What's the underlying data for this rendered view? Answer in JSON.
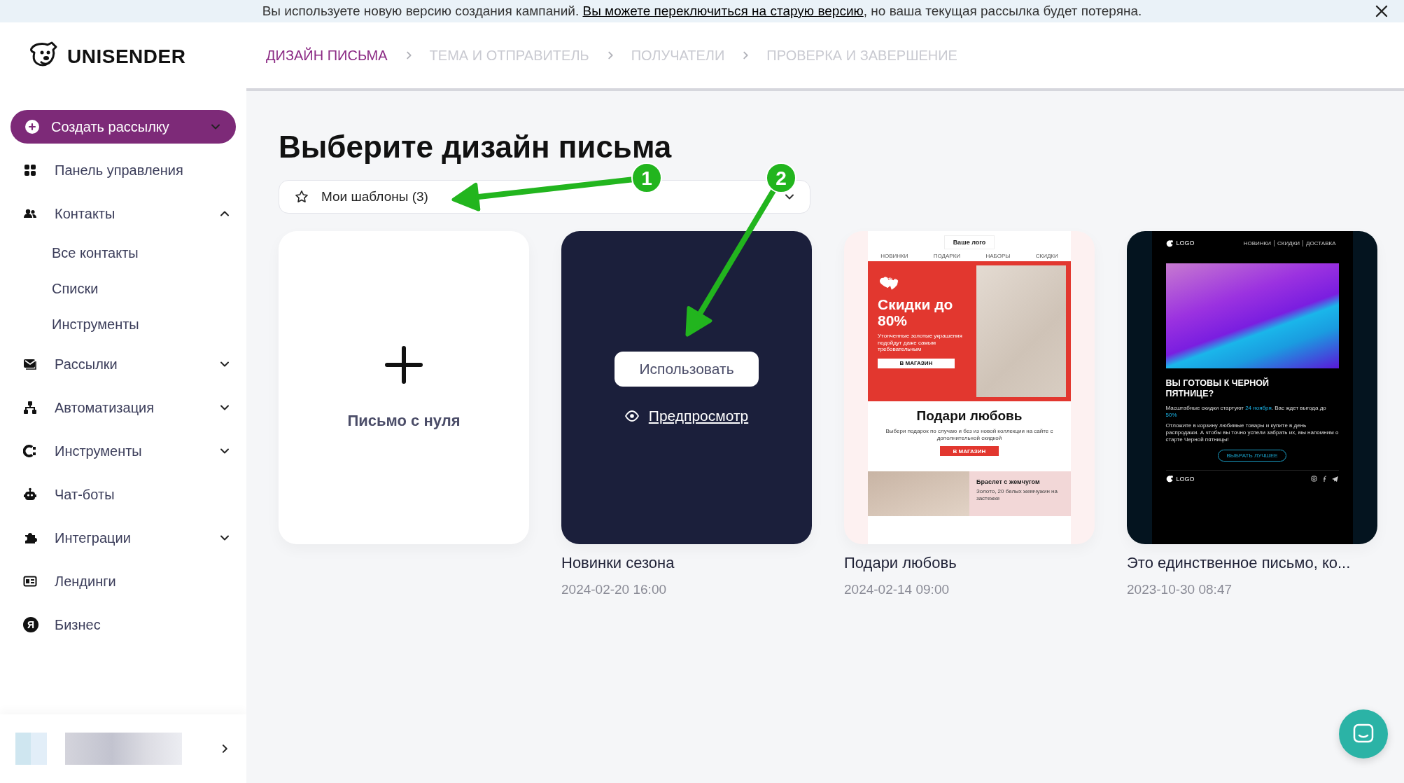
{
  "banner": {
    "text": "Вы используете новую версию создания кампаний.",
    "link": "Вы можете переключиться на старую версию",
    "text_after": ", но ваша текущая рассылка будет потеряна."
  },
  "logo": {
    "text": "UNISENDER"
  },
  "steps": [
    {
      "label": "ДИЗАЙН ПИСЬМА",
      "selected": true
    },
    {
      "label": "ТЕМА И ОТПРАВИТЕЛЬ",
      "selected": false
    },
    {
      "label": "ПОЛУЧАТЕЛИ",
      "selected": false
    },
    {
      "label": "ПРОВЕРКА И ЗАВЕРШЕНИЕ",
      "selected": false
    }
  ],
  "sidebar": {
    "create_button": {
      "label": "Создать рассылку",
      "expanded": false
    },
    "items": [
      {
        "label": "Панель управления"
      },
      {
        "label": "Контакты",
        "expanded": true,
        "children": [
          {
            "label": "Все контакты"
          },
          {
            "label": "Списки"
          },
          {
            "label": "Инструменты"
          }
        ]
      },
      {
        "label": "Рассылки",
        "expanded": false
      },
      {
        "label": "Автоматизация",
        "expanded": false
      },
      {
        "label": "Инструменты",
        "expanded": false
      },
      {
        "label": "Чат-боты"
      },
      {
        "label": "Интеграции",
        "expanded": false
      },
      {
        "label": "Лендинги"
      },
      {
        "label": "Бизнес",
        "icon_text": "Я"
      }
    ]
  },
  "page_title": "Выберите дизайн письма",
  "filter": {
    "label": "Мои шаблоны (3)"
  },
  "blank_card": {
    "label": "Письмо с нуля"
  },
  "templates": [
    {
      "kind": "hover",
      "name": "Новинки сезона",
      "date": "2024-02-20 16:00",
      "use_button": "Использовать",
      "preview_link": "Предпросмотр"
    },
    {
      "kind": "love",
      "name": "Подари любовь",
      "date": "2024-02-14 09:00",
      "preview": {
        "logo_box": "Ваше лого",
        "nav": [
          "НОВИНКИ",
          "ПОДАРКИ",
          "НАБОРЫ",
          "СКИДКИ"
        ],
        "hero_title": "Скидки до 80%",
        "hero_text": "Утонченные золотые украшения подойдут даже самым требовательным",
        "hero_button": "В МАГАЗИН",
        "title": "Подари любовь",
        "text": "Выбери подарок по случаю и без из новой коллекции на сайте с дополнительной скидкой",
        "button": "В МАГАЗИН",
        "product_title": "Браслет с жемчугом",
        "product_text": "Золото, 20 белых жемчужин на застежке"
      }
    },
    {
      "kind": "sale",
      "name": "Это единственное письмо, ко...",
      "date": "2023-10-30 08:47",
      "preview": {
        "logo": "LOGO",
        "nav": [
          "НОВИНКИ",
          "СКИДКИ",
          "ДОСТАВКА"
        ],
        "heading": "ВЫ ГОТОВЫ К ЧЕРНОЙ ПЯТНИЦЕ?",
        "text1": "Масштабные скидки стартуют **24 ноября**. Вас ждет выгода до **50%**",
        "text2": "Отложите в корзину любимые товары и купите в день распродажи. А чтобы вы точно успели забрать их, мы напомним о старте Черной пятницы!",
        "button": "ВЫБРАТЬ ЛУЧШЕЕ",
        "footer_logo": "LOGO"
      }
    }
  ],
  "annotations": [
    {
      "label": "1"
    },
    {
      "label": "2"
    }
  ]
}
